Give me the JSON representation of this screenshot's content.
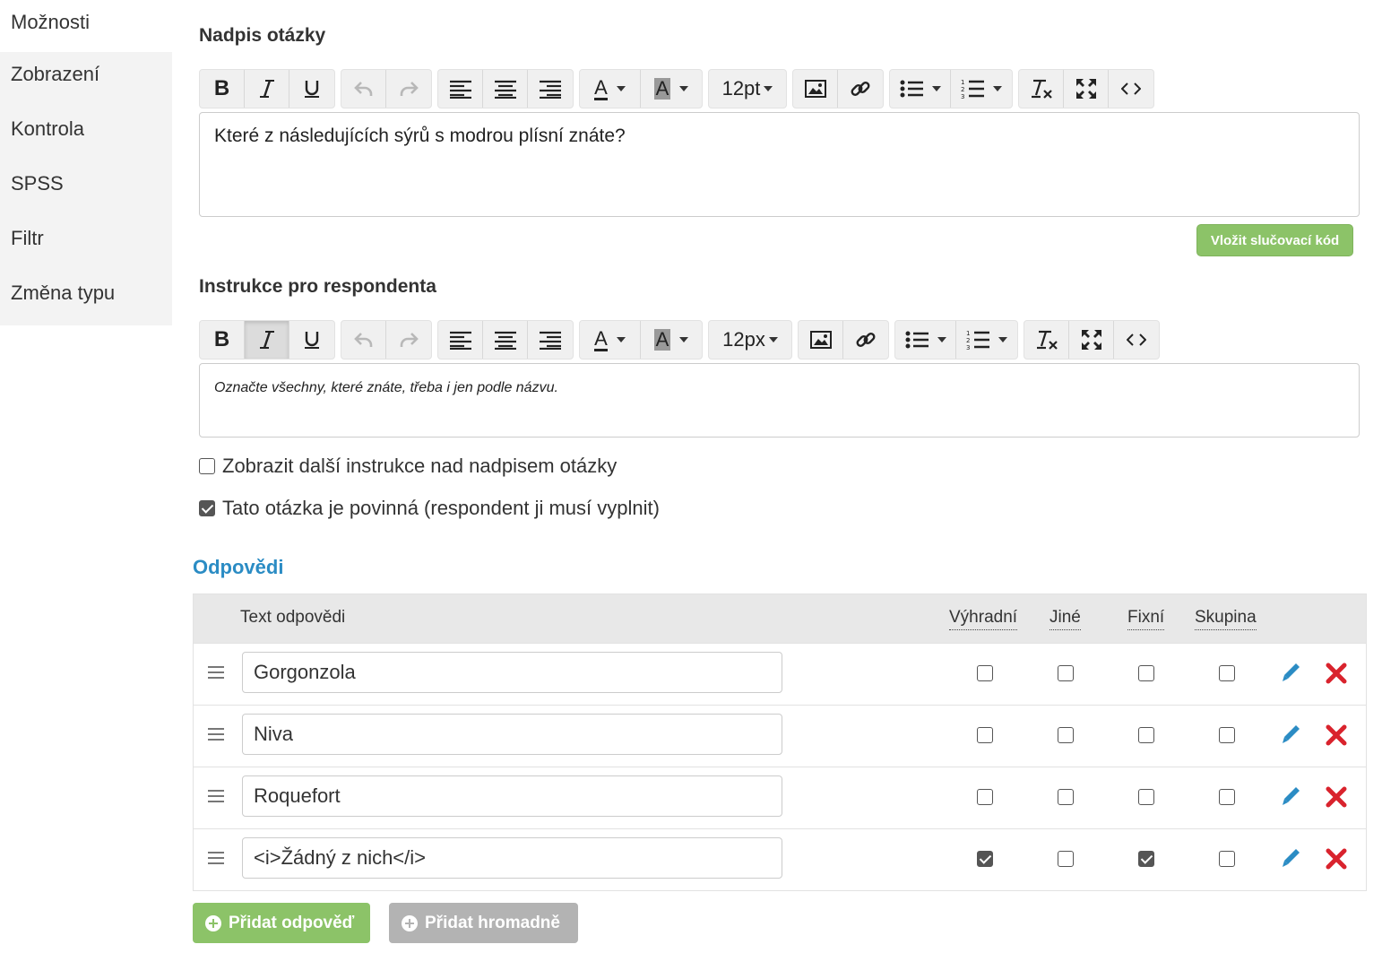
{
  "sidebar": {
    "items": [
      {
        "label": "Možnosti"
      },
      {
        "label": "Zobrazení"
      },
      {
        "label": "Kontrola"
      },
      {
        "label": "SPSS"
      },
      {
        "label": "Filtr"
      },
      {
        "label": "Změna typu"
      }
    ]
  },
  "question": {
    "heading": "Nadpis otázky",
    "font_size": "12pt",
    "text": "Které z následujících sýrů s modrou plísní znáte?",
    "merge_button": "Vložit slučovací kód"
  },
  "instructions": {
    "heading": "Instrukce pro respondenta",
    "font_size": "12px",
    "text": "Označte všechny, které znáte, třeba i jen podle názvu."
  },
  "options": {
    "show_above": {
      "label": "Zobrazit další instrukce nad nadpisem otázky",
      "checked": false
    },
    "required": {
      "label": "Tato otázka je povinná (respondent ji musí vyplnit)",
      "checked": true
    }
  },
  "answers": {
    "title": "Odpovědi",
    "columns": {
      "text": "Text odpovědi",
      "exclusive": "Výhradní",
      "other": "Jiné",
      "fixed": "Fixní",
      "group": "Skupina"
    },
    "rows": [
      {
        "text": "Gorgonzola",
        "exclusive": false,
        "other": false,
        "fixed": false,
        "group": false
      },
      {
        "text": "Niva",
        "exclusive": false,
        "other": false,
        "fixed": false,
        "group": false
      },
      {
        "text": "Roquefort",
        "exclusive": false,
        "other": false,
        "fixed": false,
        "group": false
      },
      {
        "text": "<i>Žádný z nich</i>",
        "exclusive": true,
        "other": false,
        "fixed": true,
        "group": false
      }
    ],
    "add_button": "Přidat odpověď",
    "bulk_button": "Přidat hromadně"
  },
  "colors": {
    "green": "#8cc368",
    "gray": "#b3b3b3",
    "blue": "#2b8cc4",
    "red": "#d9232d"
  }
}
